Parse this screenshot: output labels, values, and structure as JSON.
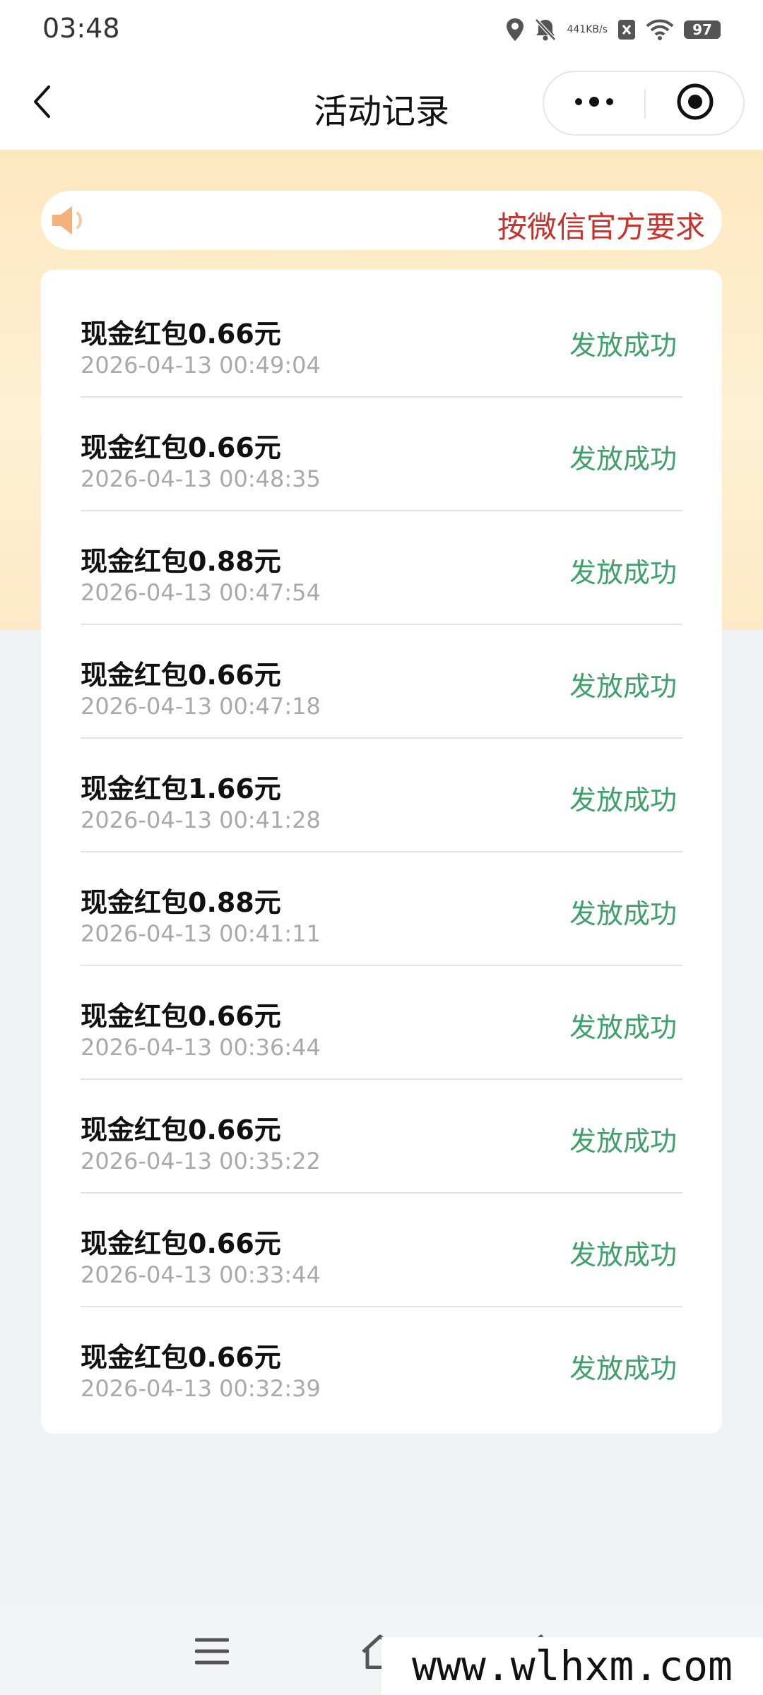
{
  "status_bar": {
    "time": "03:48",
    "net_speed_value": "441",
    "net_speed_unit": "KB/s",
    "battery": "97",
    "icons": [
      "location-icon",
      "mute-bell-icon",
      "notification-x-icon",
      "wifi-icon",
      "battery-icon"
    ]
  },
  "nav": {
    "title": "活动记录",
    "icons": [
      "back-arrow-icon",
      "more-dots-icon",
      "mini-program-close-icon"
    ]
  },
  "notice": {
    "text": "按微信官方要求",
    "icon": "speaker-icon",
    "color": "#c8322d"
  },
  "records": [
    {
      "title": "现金红包0.66元",
      "time": "2026-04-13 00:49:04",
      "status": "发放成功"
    },
    {
      "title": "现金红包0.66元",
      "time": "2026-04-13 00:48:35",
      "status": "发放成功"
    },
    {
      "title": "现金红包0.88元",
      "time": "2026-04-13 00:47:54",
      "status": "发放成功"
    },
    {
      "title": "现金红包0.66元",
      "time": "2026-04-13 00:47:18",
      "status": "发放成功"
    },
    {
      "title": "现金红包1.66元",
      "time": "2026-04-13 00:41:28",
      "status": "发放成功"
    },
    {
      "title": "现金红包0.88元",
      "time": "2026-04-13 00:41:11",
      "status": "发放成功"
    },
    {
      "title": "现金红包0.66元",
      "time": "2026-04-13 00:36:44",
      "status": "发放成功"
    },
    {
      "title": "现金红包0.66元",
      "time": "2026-04-13 00:35:22",
      "status": "发放成功"
    },
    {
      "title": "现金红包0.66元",
      "time": "2026-04-13 00:33:44",
      "status": "发放成功"
    },
    {
      "title": "现金红包0.66元",
      "time": "2026-04-13 00:32:39",
      "status": "发放成功"
    }
  ],
  "colors": {
    "status_success": "#3fa06a",
    "hero_gradient": "#fde7bf"
  },
  "system_nav": {
    "icons": [
      "menu-icon",
      "home-icon",
      "back-icon"
    ]
  },
  "watermark": "www.wlhxm.com"
}
